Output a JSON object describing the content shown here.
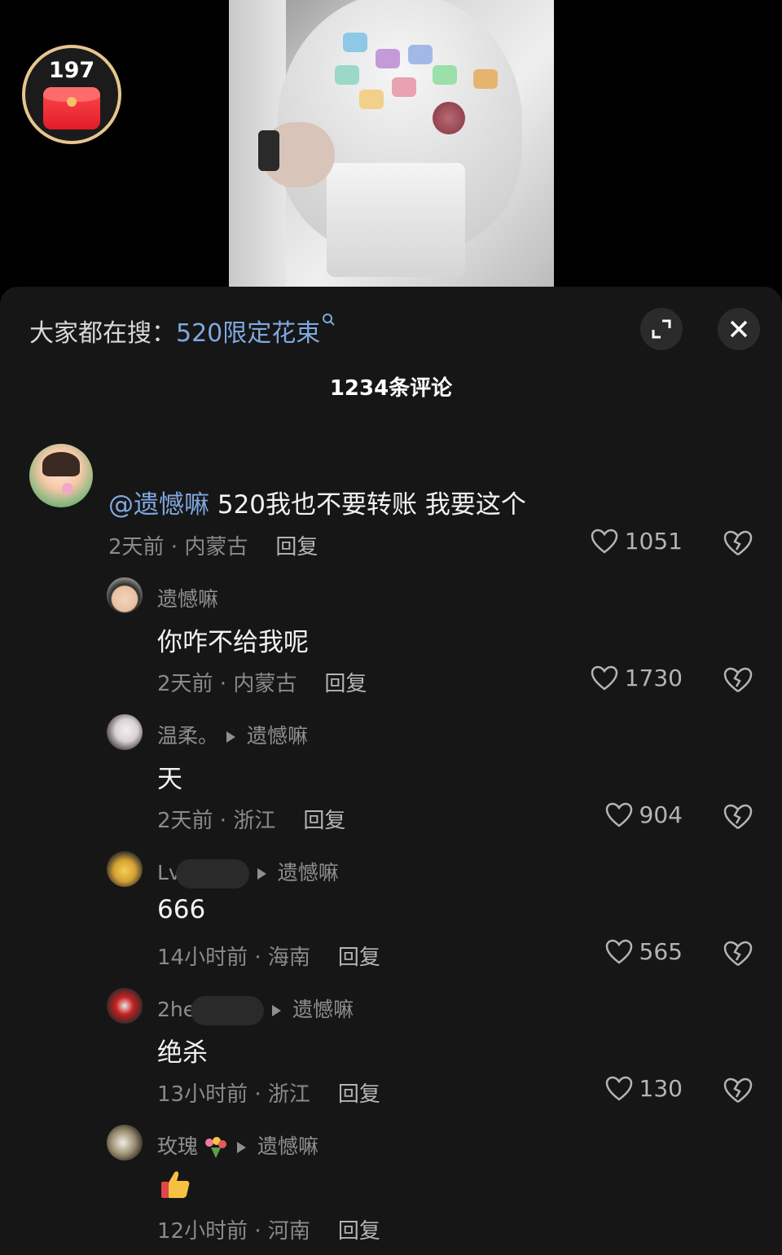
{
  "video": {
    "redpacket_count": "197",
    "colors": {
      "redpacket": "#e11d2a",
      "ring": "#e6c58f"
    }
  },
  "panel": {
    "search_prefix": "大家都在搜：",
    "search_keyword": "520限定花束",
    "comment_count": "1234条评论"
  },
  "comments": [
    {
      "mention": "@遗憾嘛",
      "text": " 520我也不要转账 我要这个",
      "meta": "2天前 · 内蒙古",
      "reply": "回复",
      "likes": "1051"
    },
    {
      "user": "遗憾嘛",
      "text": "你咋不给我呢",
      "meta": "2天前 · 内蒙古",
      "reply": "回复",
      "likes": "1730"
    },
    {
      "user": "温柔。",
      "reply_to": "遗憾嘛",
      "text": "天",
      "meta": "2天前 · 浙江",
      "reply": "回复",
      "likes": "904"
    },
    {
      "user": "Lv",
      "reply_to": "遗憾嘛",
      "text": "666",
      "meta": "14小时前 · 海南",
      "reply": "回复",
      "likes": "565"
    },
    {
      "user": "2he",
      "reply_to": "遗憾嘛",
      "text": "绝杀",
      "meta": "13小时前 · 浙江",
      "reply": "回复",
      "likes": "130"
    },
    {
      "user": "玫瑰",
      "reply_to": "遗憾嘛",
      "text_emoji": "thumbs-up",
      "meta": "12小时前 · 河南",
      "reply": "回复"
    }
  ],
  "colors": {
    "accent": "#7fa8e0",
    "panel_bg": "#161616"
  }
}
